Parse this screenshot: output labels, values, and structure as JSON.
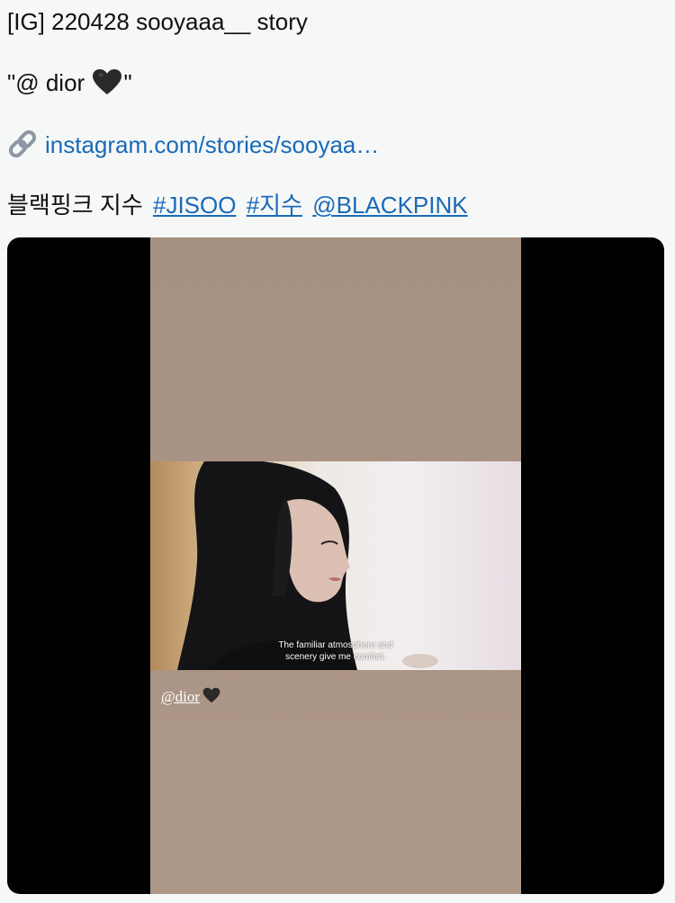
{
  "post": {
    "title": "[IG] 220428 sooyaaa__ story",
    "quote_open": "\"@ dior",
    "quote_close": "\"",
    "link_text": "instagram.com/stories/sooyaa…",
    "caption_text": "블랙핑크 지수",
    "tags": [
      "#JISOO",
      "#지수",
      "@BLACKPINK"
    ],
    "colors": {
      "link": "#1a6ab8",
      "text": "#111111",
      "background": "#f6f8f8"
    }
  },
  "media": {
    "subtitle_line1": "The familiar atmosphere and",
    "subtitle_line2": "scenery give me comfort.",
    "sticker_mention": "@dior",
    "icons": [
      "black-heart-icon",
      "link-icon"
    ]
  }
}
